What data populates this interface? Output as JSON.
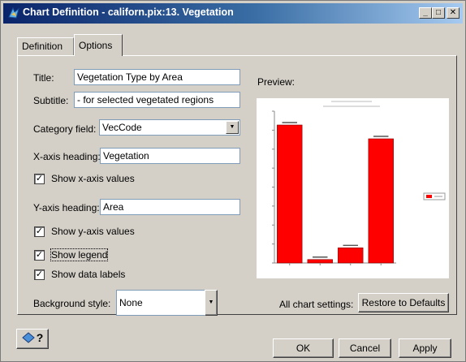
{
  "window": {
    "title": "Chart Definition - californ.pix:13. Vegetation"
  },
  "title_buttons": {
    "minimize": "_",
    "maximize": "□",
    "close": "✕"
  },
  "tabs": {
    "definition": "Definition",
    "options": "Options"
  },
  "form": {
    "title_label": "Title:",
    "title_value": "Vegetation Type by Area",
    "subtitle_label": "Subtitle:",
    "subtitle_value": "- for selected vegetated regions",
    "category_label": "Category field:",
    "category_value": "VecCode",
    "xaxis_label": "X-axis heading:",
    "xaxis_value": "Vegetation",
    "show_x_label": "Show x-axis values",
    "show_x_checked": true,
    "yaxis_label": "Y-axis heading:",
    "yaxis_value": "Area",
    "show_y_label": "Show y-axis values",
    "show_y_checked": true,
    "show_legend_label": "Show legend",
    "show_legend_checked": true,
    "show_datalabels_label": "Show data labels",
    "show_datalabels_checked": true,
    "bgstyle_label": "Background style:",
    "bgstyle_value": "None"
  },
  "preview": {
    "label": "Preview:",
    "all_settings_label": "All chart settings:",
    "restore_button": "Restore to Defaults"
  },
  "footer": {
    "help_icon_glyph": "?",
    "ok": "OK",
    "cancel": "Cancel",
    "apply": "Apply"
  },
  "colors": {
    "bar": "#ff0000",
    "title_bar_start": "#0a246a",
    "title_bar_end": "#a6caf0"
  },
  "chart_data": {
    "type": "bar",
    "categories": [
      "",
      "",
      "",
      ""
    ],
    "values": [
      1000,
      25,
      110,
      900
    ],
    "ylim": [
      0,
      1100
    ],
    "legend_placement": "right",
    "grid": false
  }
}
